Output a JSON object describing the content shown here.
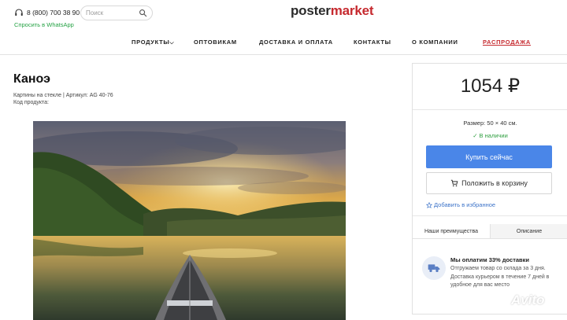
{
  "header": {
    "phone": "8 (800) 700 38 90",
    "whatsapp_link": "Спросить в WhatsApp",
    "search_placeholder": "Поиск",
    "logo_part1": "poster",
    "logo_part2": "market"
  },
  "nav": {
    "items": [
      {
        "label": "ПРОДУКТЫ",
        "has_dropdown": true
      },
      {
        "label": "ОПТОВИКАМ"
      },
      {
        "label": "ДОСТАВКА И ОПЛАТА"
      },
      {
        "label": "КОНТАКТЫ"
      },
      {
        "label": "О КОМПАНИИ"
      },
      {
        "label": "РАСПРОДАЖА",
        "highlight": true
      }
    ],
    "chevron": "⌵"
  },
  "product": {
    "title": "Каноэ",
    "breadcrumb": "Картины на стекле | Артикул: AG 40-76",
    "code_label": "Код продукта:"
  },
  "buy_panel": {
    "price": "1054 ₽",
    "size": "Размер: 50 × 40 см.",
    "stock": "✓ В наличии",
    "buy_now": "Купить сейчас",
    "add_to_cart": "Положить в корзину",
    "add_to_favorites": "Добавить в избранное",
    "tabs": [
      "Наши преимущества",
      "Описание"
    ],
    "advantage_title": "Мы оплатим 33% доставки",
    "advantage_text": "Отгружаем товар со склада за 3 дня. Доставка курьером в течение 7 дней в удобное для вас место"
  },
  "watermark": {
    "text": "Avito"
  },
  "colors": {
    "brand_red": "#c62a2f",
    "buy_button": "#4a86e8",
    "whatsapp_green": "#25a244",
    "stock_green": "#2e9e3f",
    "link_blue": "#3d74c9"
  },
  "icons": [
    "headset-icon",
    "search-icon",
    "cart-icon",
    "star-icon",
    "truck-icon",
    "avito-logo-icon"
  ]
}
